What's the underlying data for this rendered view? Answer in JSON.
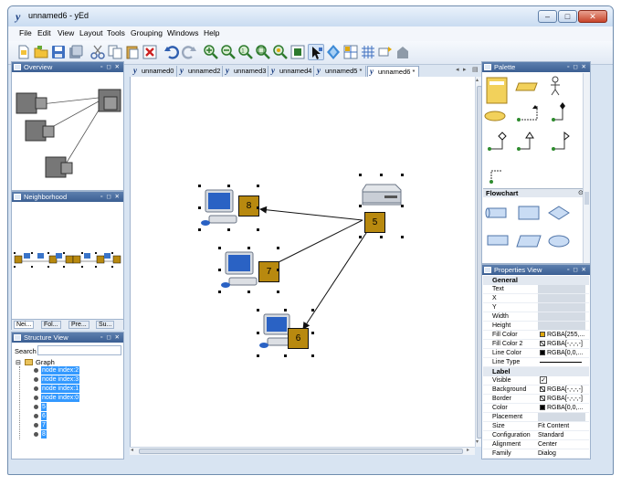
{
  "window": {
    "title": "unnamed6 - yEd",
    "logo_glyph": "y",
    "minimize": "–",
    "maximize": "□",
    "close": "✕"
  },
  "menu": [
    "File",
    "Edit",
    "View",
    "Layout",
    "Tools",
    "Grouping",
    "Windows",
    "Help"
  ],
  "toolbar_icons": [
    "new-icon",
    "open-icon",
    "save-icon",
    "save-as-icon",
    "cut-icon",
    "copy-icon",
    "paste-icon",
    "delete-icon",
    "undo-icon",
    "redo-icon",
    "zoom-in-icon",
    "zoom-out-icon",
    "zoom-fit-icon",
    "zoom-area-icon",
    "zoom-selection-icon",
    "fit-content-icon",
    "edit-mode-icon",
    "navigate-mode-icon",
    "grid-icon",
    "snap-grid-icon",
    "label-icon",
    "group-icon"
  ],
  "overview": {
    "title": "Overview"
  },
  "neighborhood": {
    "title": "Neighborhood",
    "tabs": [
      "Nei...",
      "Fol...",
      "Pre...",
      "Su..."
    ]
  },
  "structure": {
    "title": "Structure View",
    "search_label": "Search",
    "search_value": "",
    "root": "Graph",
    "items": [
      "node index:2",
      "node index:3",
      "node index:1",
      "node index:0",
      "5",
      "6",
      "7",
      "8"
    ]
  },
  "doc_tabs": [
    {
      "label": "unnamed0 *",
      "selected": false
    },
    {
      "label": "unnamed2",
      "selected": false
    },
    {
      "label": "unnamed3",
      "selected": false
    },
    {
      "label": "unnamed4",
      "selected": false
    },
    {
      "label": "unnamed5 *",
      "selected": false
    },
    {
      "label": "unnamed6 *",
      "selected": true
    }
  ],
  "graph": {
    "nodes": [
      {
        "label": "8",
        "kind": "workstation"
      },
      {
        "label": "5",
        "kind": "server"
      },
      {
        "label": "7",
        "kind": "workstation"
      },
      {
        "label": "6",
        "kind": "workstation"
      }
    ],
    "edges": [
      {
        "from": "5",
        "to": "8"
      },
      {
        "from": "5",
        "to": "7"
      },
      {
        "from": "5",
        "to": "6"
      }
    ],
    "node_color": "#b8890f"
  },
  "palette": {
    "title": "Palette",
    "section": "Flowchart",
    "section_toggle": "⊙"
  },
  "properties": {
    "title": "Properties View",
    "sections": [
      {
        "name": "General",
        "rows": [
          {
            "key": "Text",
            "value": ""
          },
          {
            "key": "X",
            "value": ""
          },
          {
            "key": "Y",
            "value": ""
          },
          {
            "key": "Width",
            "value": ""
          },
          {
            "key": "Height",
            "value": ""
          },
          {
            "key": "Fill Color",
            "value": "RGBA[255,...",
            "swatch": "#e0a80c"
          },
          {
            "key": "Fill Color 2",
            "value": "RGBA[-,-,-,-]",
            "swatch": "cross"
          },
          {
            "key": "Line Color",
            "value": "RGBA[0,0,...",
            "swatch": "#000000"
          },
          {
            "key": "Line Type",
            "value": "",
            "line": true
          }
        ]
      },
      {
        "name": "Label",
        "rows": [
          {
            "key": "Visible",
            "value": "✓",
            "check": true
          },
          {
            "key": "Background",
            "value": "RGBA[-,-,-,-]",
            "swatch": "cross"
          },
          {
            "key": "Border",
            "value": "RGBA[-,-,-,-]",
            "swatch": "cross"
          },
          {
            "key": "Color",
            "value": "RGBA[0,0,...",
            "swatch": "#000000"
          },
          {
            "key": "Placement",
            "value": ""
          },
          {
            "key": "Size",
            "value": "Fit Content"
          },
          {
            "key": "Configuration",
            "value": "Standard"
          },
          {
            "key": "Alignment",
            "value": "Center"
          },
          {
            "key": "Family",
            "value": "Dialog"
          },
          {
            "key": "Font Size",
            "value": ""
          }
        ]
      }
    ]
  },
  "colors": {
    "panel_header": "#3b5f93",
    "selection": "#3399ff",
    "node_fill": "#b8890f"
  }
}
